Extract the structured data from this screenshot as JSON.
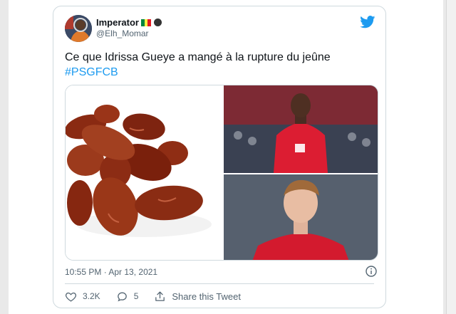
{
  "tweet": {
    "display_name": "Imperator",
    "handle": "@Elh_Momar",
    "text": "Ce que Idrissa Gueye a mangé à la rupture du jeûne",
    "hashtag": "#PSGFCB",
    "timestamp": "10:55 PM · Apr 13, 2021"
  },
  "actions": {
    "likes": "3.2K",
    "replies": "5",
    "share_label": "Share this Tweet"
  },
  "colors": {
    "accent": "#1d9bf0",
    "text": "#0f1419",
    "muted": "#536471",
    "border": "#cfd9de"
  },
  "icons": [
    "twitter-bird-icon",
    "info-icon",
    "heart-icon",
    "reply-icon",
    "share-icon",
    "senegal-flag-icon",
    "ninja-emoji-icon"
  ]
}
